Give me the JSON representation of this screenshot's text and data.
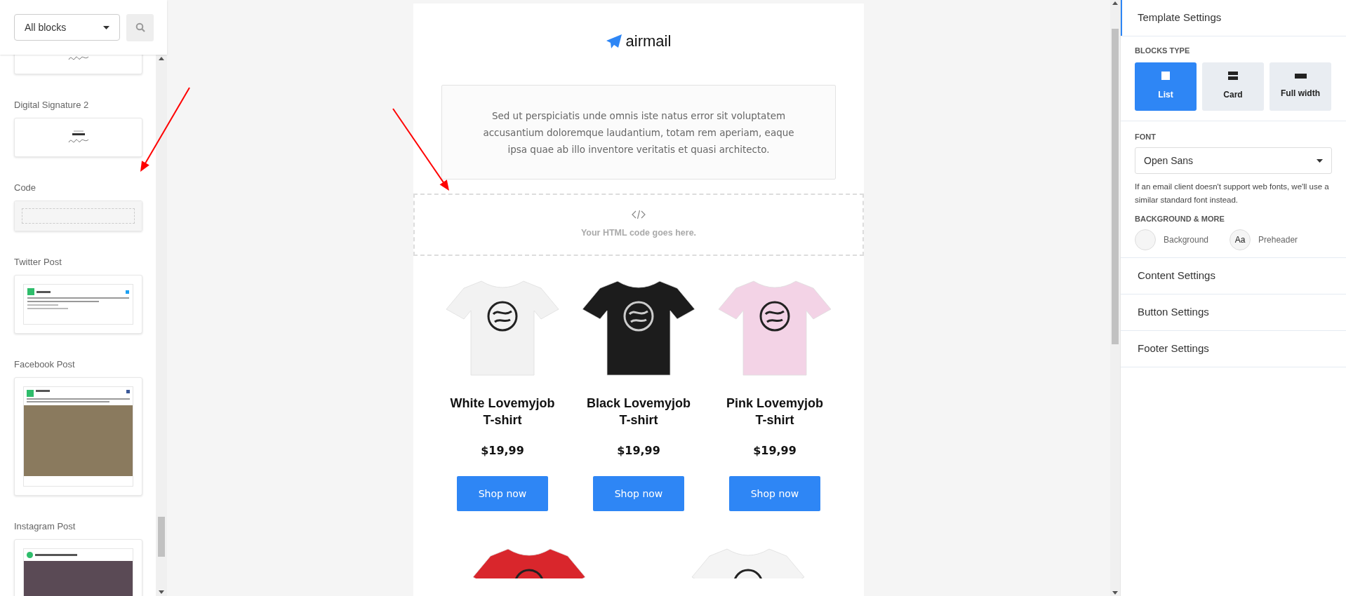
{
  "sidebar": {
    "filter": {
      "value": "All blocks"
    },
    "blocks": [
      {
        "kind": "signature"
      },
      {
        "title": "Digital Signature 2",
        "kind": "signature"
      },
      {
        "title": "Code",
        "kind": "code"
      },
      {
        "title": "Twitter Post",
        "kind": "twitter"
      },
      {
        "title": "Facebook Post",
        "kind": "facebook"
      },
      {
        "title": "Instagram Post",
        "kind": "instagram"
      }
    ]
  },
  "email": {
    "logo": "airmail",
    "intro": "Sed ut perspiciatis unde omnis iste natus error sit voluptatem accusantium doloremque laudantium, totam rem aperiam, eaque ipsa quae ab illo inventore veritatis et quasi architecto.",
    "code_placeholder": "Your HTML code goes here.",
    "products": [
      {
        "name": "White Lovemyjob T-shirt",
        "price": "$19,99",
        "button": "Shop now",
        "color": "#f2f2f2"
      },
      {
        "name": "Black Lovemyjob T-shirt",
        "price": "$19,99",
        "button": "Shop now",
        "color": "#1c1c1c"
      },
      {
        "name": "Pink Lovemyjob T-shirt",
        "price": "$19,99",
        "button": "Shop now",
        "color": "#f3d3e6"
      }
    ],
    "more_products": [
      {
        "color": "#d9262c"
      },
      {
        "color": "#f4f4f4"
      }
    ]
  },
  "settings": {
    "sections": [
      {
        "title": "Template Settings",
        "expanded": true
      },
      {
        "title": "Content Settings",
        "expanded": false
      },
      {
        "title": "Button Settings",
        "expanded": false
      },
      {
        "title": "Footer Settings",
        "expanded": false
      }
    ],
    "blocks_type": {
      "label": "BLOCKS TYPE",
      "options": [
        {
          "label": "List",
          "kind": "list",
          "selected": true
        },
        {
          "label": "Card",
          "kind": "card",
          "selected": false
        },
        {
          "label": "Full width",
          "kind": "full",
          "selected": false
        }
      ]
    },
    "font": {
      "label": "FONT",
      "value": "Open Sans",
      "hint": "If an email client doesn't support web fonts, we'll use a similar standard font instead."
    },
    "background": {
      "label": "BACKGROUND & MORE",
      "items": [
        {
          "label": "Background",
          "kind": "swatch"
        },
        {
          "label": "Preheader",
          "kind": "glyph",
          "glyph": "Aa"
        }
      ]
    }
  }
}
